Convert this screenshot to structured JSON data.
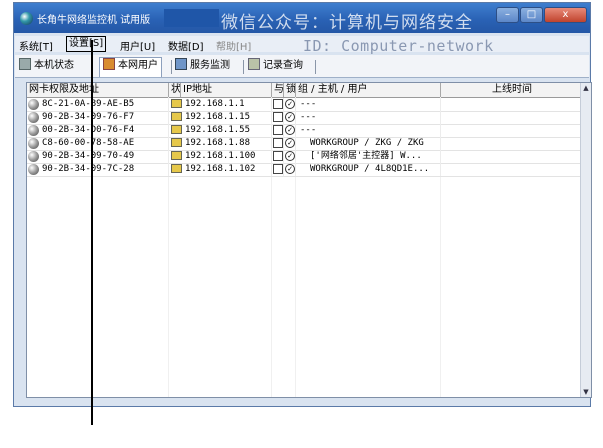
{
  "window": {
    "title": "长角牛网络监控机 试用版",
    "buttons": {
      "minimize": "–",
      "maximize": "□",
      "close": "x"
    }
  },
  "watermark": {
    "line1": "微信公众号：计算机与网络安全",
    "line2": "ID: Computer-network"
  },
  "menu": [
    {
      "label": "系统[T]"
    },
    {
      "label": "设置[S]"
    },
    {
      "label": "用户[U]"
    },
    {
      "label": "数据[D]"
    },
    {
      "label": "帮助[H]"
    }
  ],
  "tabs": [
    {
      "label": "本机状态",
      "icon": "machine-state-icon"
    },
    {
      "label": "本网用户",
      "icon": "network-users-icon"
    },
    {
      "label": "服务监测",
      "icon": "service-monitor-icon"
    },
    {
      "label": "记录查询",
      "icon": "record-query-icon"
    }
  ],
  "table": {
    "headers": [
      "网卡权限及地址",
      "状",
      "IP地址",
      "与",
      "锁",
      "组 / 主机 / 用户",
      "上线时间"
    ],
    "rows": [
      {
        "mac": "8C-21-0A-89-AE-B5",
        "ip": "192.168.1.1",
        "group": "---"
      },
      {
        "mac": "90-2B-34-09-76-F7",
        "ip": "192.168.1.15",
        "group": "---"
      },
      {
        "mac": "00-2B-34-D0-76-F4",
        "ip": "192.168.1.55",
        "group": "---"
      },
      {
        "mac": "C8-60-00-78-58-AE",
        "ip": "192.168.1.88",
        "group": "WORKGROUP / ZKG / ZKG"
      },
      {
        "mac": "90-2B-34-09-70-49",
        "ip": "192.168.1.100",
        "group": "['网络邻居'主控器] W..."
      },
      {
        "mac": "90-2B-34-09-7C-28",
        "ip": "192.168.1.102",
        "group": "WORKGROUP / 4L8QD1E..."
      }
    ]
  }
}
